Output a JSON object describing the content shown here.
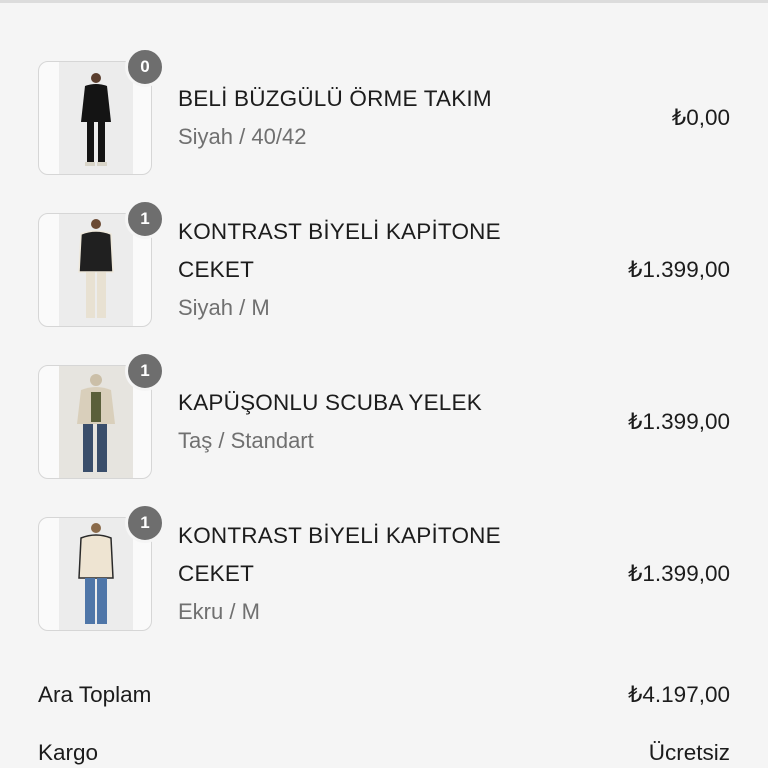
{
  "cart": {
    "items": [
      {
        "title_line1": "BELİ BÜZGÜLÜ ÖRME TAKIM",
        "title_line2": "",
        "variant": "Siyah / 40/42",
        "price": "₺0,00",
        "quantity": "0",
        "image_icon": "product-thumbnail-black-knit-set"
      },
      {
        "title_line1": "KONTRAST BİYELİ KAPİTONE",
        "title_line2": "CEKET",
        "variant": "Siyah / M",
        "price": "₺1.399,00",
        "quantity": "1",
        "image_icon": "product-thumbnail-black-quilted-jacket"
      },
      {
        "title_line1": "KAPÜŞONLU SCUBA YELEK",
        "title_line2": "",
        "variant": "Taş / Standart",
        "price": "₺1.399,00",
        "quantity": "1",
        "image_icon": "product-thumbnail-stone-vest"
      },
      {
        "title_line1": "KONTRAST BİYELİ KAPİTONE",
        "title_line2": "CEKET",
        "variant": "Ekru / M",
        "price": "₺1.399,00",
        "quantity": "1",
        "image_icon": "product-thumbnail-ecru-quilted-jacket"
      }
    ]
  },
  "summary": {
    "subtotal_label": "Ara Toplam",
    "subtotal_value": "₺4.197,00",
    "shipping_label": "Kargo",
    "shipping_value": "Ücretsiz"
  },
  "colors": {
    "background": "#f5f5f5",
    "badge": "#6e6e6e",
    "text": "#1c1c1c",
    "muted": "#707070"
  }
}
